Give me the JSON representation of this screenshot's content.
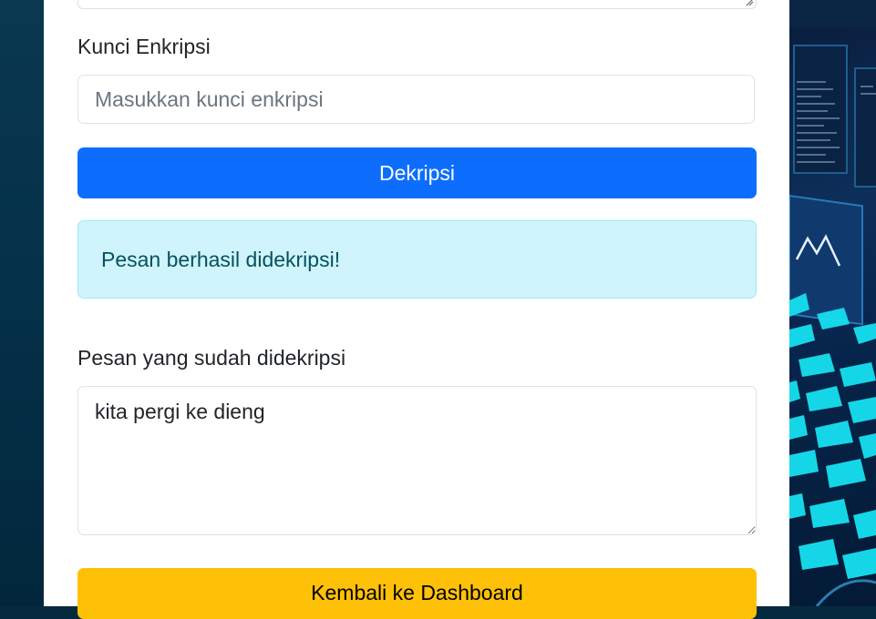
{
  "form": {
    "key_label": "Kunci Enkripsi",
    "key_placeholder": "Masukkan kunci enkripsi",
    "decrypt_button": "Dekripsi",
    "alert_message": "Pesan berhasil didekripsi!",
    "result_label": "Pesan yang sudah didekripsi",
    "result_value": "kita pergi ke dieng",
    "back_button": "Kembali ke Dashboard"
  },
  "colors": {
    "primary": "#0d6efd",
    "warning": "#ffc107",
    "info_bg": "#cff4fc",
    "info_text": "#055160"
  }
}
